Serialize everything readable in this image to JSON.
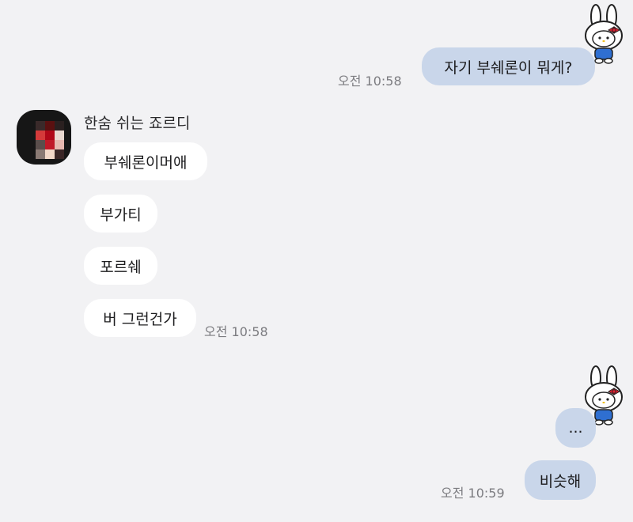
{
  "messages_top": {
    "outgoing_question": "자기 부쉐론이 뭐게?",
    "outgoing_question_time": "오전 10:58"
  },
  "incoming": {
    "sender_name": "한숨 쉬는 죠르디",
    "bubbles": [
      "부쉐론이머애",
      "부가티",
      "포르쉐",
      "버 그런건가"
    ],
    "last_time": "오전 10:58"
  },
  "messages_bottom": {
    "ellipsis": "...",
    "reply": "비슷해",
    "reply_time": "오전 10:59"
  },
  "icons": {
    "sticker": "bunny-kitty-avatar-icon",
    "avatar": "pixelated-profile-avatar"
  },
  "colors": {
    "background": "#f2f2f4",
    "outgoing_bubble": "#c9d6ea",
    "incoming_bubble": "#ffffff",
    "timestamp": "#7c7c80"
  }
}
